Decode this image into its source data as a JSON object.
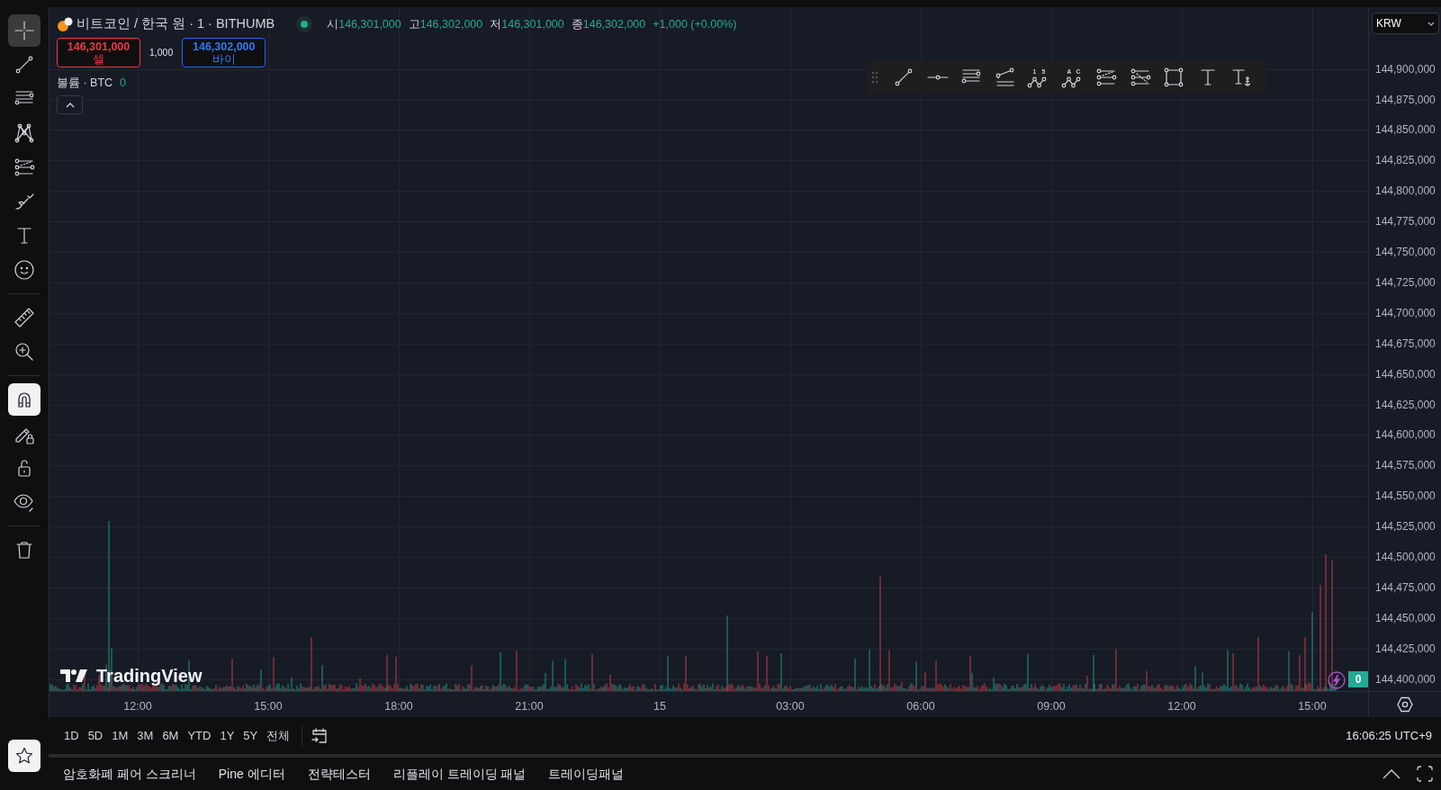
{
  "symbol": {
    "title": "비트코인 / 한국 원 · 1 · BITHUMB",
    "market_open": true,
    "ohlc": [
      {
        "label": "시",
        "value": "146,301,000"
      },
      {
        "label": "고",
        "value": "146,302,000"
      },
      {
        "label": "저",
        "value": "146,301,000"
      },
      {
        "label": "종",
        "value": "146,302,000"
      }
    ],
    "change": "+1,000 (+0.00%)"
  },
  "trade": {
    "sell": {
      "price": "146,301,000",
      "label": "셀"
    },
    "spread": "1,000",
    "buy": {
      "price": "146,302,000",
      "label": "바이"
    }
  },
  "volume_legend": {
    "label": "볼륨 · BTC",
    "value": "0"
  },
  "left_toolbar": [
    {
      "tools": [
        {
          "kind": "crosshair",
          "selected": true
        },
        {
          "kind": "trend-line",
          "selected": false
        },
        {
          "kind": "fib-retracement",
          "selected": false
        },
        {
          "kind": "xabcd",
          "selected": false
        },
        {
          "kind": "fib-extension",
          "selected": false
        },
        {
          "kind": "brush",
          "selected": false
        },
        {
          "kind": "text",
          "selected": false
        },
        {
          "kind": "emoji",
          "selected": false
        }
      ]
    },
    {
      "tools": [
        {
          "kind": "ruler",
          "selected": false
        },
        {
          "kind": "zoom-in",
          "selected": false
        }
      ]
    },
    {
      "tools": [
        {
          "kind": "magnet",
          "on": true
        },
        {
          "kind": "draw-lock",
          "on": false
        },
        {
          "kind": "lock",
          "on": false
        },
        {
          "kind": "eye",
          "on": false
        }
      ]
    },
    {
      "tools": [
        {
          "kind": "trash",
          "selected": false
        }
      ]
    }
  ],
  "drawing_toolbar": [
    {
      "kind": "trend-line"
    },
    {
      "kind": "horizontal-ray"
    },
    {
      "kind": "fib-retracement"
    },
    {
      "kind": "fib-channel"
    },
    {
      "kind": "elliott-wave",
      "marks": [
        "1",
        "5"
      ]
    },
    {
      "kind": "abcd",
      "marks": [
        "A",
        "C"
      ]
    },
    {
      "kind": "fib-extension"
    },
    {
      "kind": "fib-trend"
    },
    {
      "kind": "rectangle"
    },
    {
      "kind": "text"
    },
    {
      "kind": "anchored-text"
    }
  ],
  "currency_select": "KRW",
  "price_axis": [
    "144,900,000",
    "144,875,000",
    "144,850,000",
    "144,825,000",
    "144,800,000",
    "144,775,000",
    "144,750,000",
    "144,725,000",
    "144,700,000",
    "144,675,000",
    "144,650,000",
    "144,625,000",
    "144,600,000",
    "144,575,000",
    "144,550,000",
    "144,525,000",
    "144,500,000",
    "144,475,000",
    "144,450,000",
    "144,425,000",
    "144,400,000"
  ],
  "last_price_badge": "0",
  "watermark": "TradingView",
  "time_axis": [
    "12:00",
    "15:00",
    "18:00",
    "21:00",
    "15",
    "03:00",
    "06:00",
    "09:00",
    "12:00",
    "15:00"
  ],
  "range_buttons": [
    "1D",
    "5D",
    "1M",
    "3M",
    "6M",
    "YTD",
    "1Y",
    "5Y",
    "전체"
  ],
  "clock": "16:06:25 UTC+9",
  "bottom_tabs": [
    "암호화폐 페어 스크리너",
    "Pine 에디터",
    "전략테스터",
    "리플레이 트레이딩 패널",
    "트레이딩패널"
  ]
}
